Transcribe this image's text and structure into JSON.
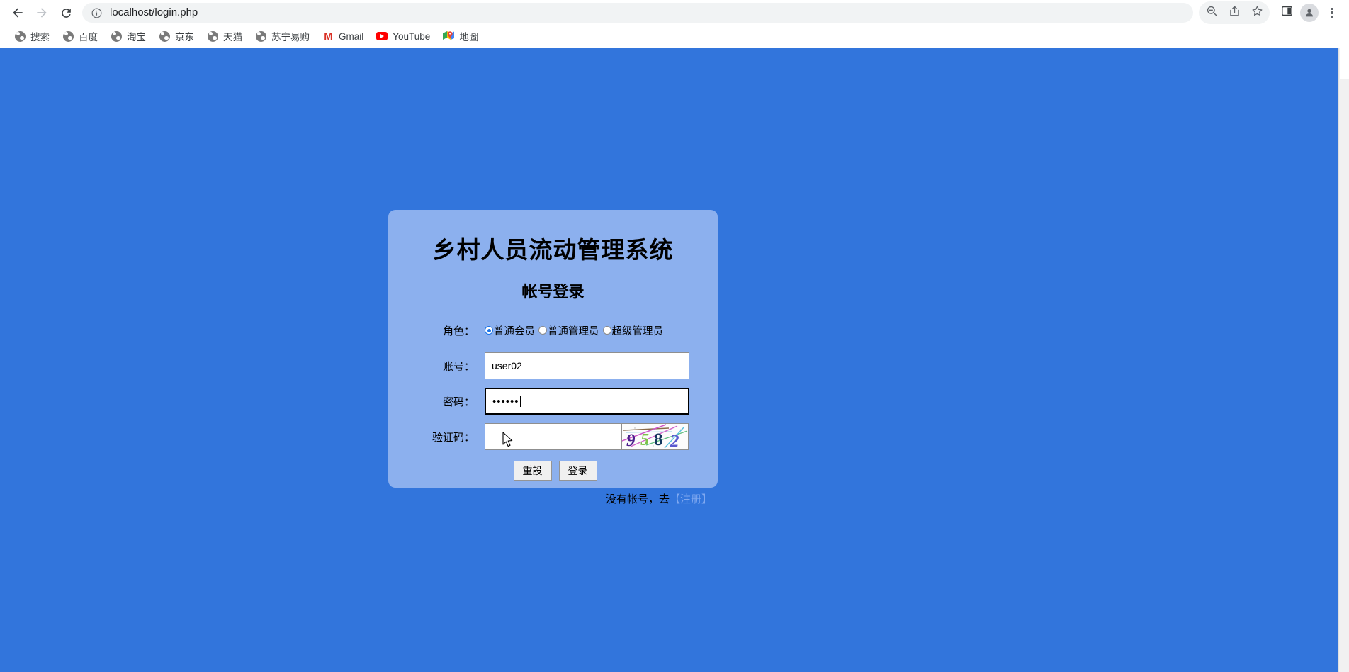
{
  "browser": {
    "nav": {
      "back_icon": "back-arrow-icon",
      "forward_icon": "forward-arrow-icon",
      "reload_icon": "reload-icon"
    },
    "omnibox": {
      "info_icon": "site-info-icon",
      "url": "localhost/login.php",
      "url_host": "localhost",
      "url_path": "/login.php"
    },
    "toolbar_icons": [
      {
        "name": "zoom-out-icon",
        "glyph": "search"
      },
      {
        "name": "share-icon",
        "glyph": "share"
      },
      {
        "name": "bookmark-star-icon",
        "glyph": "star"
      },
      {
        "name": "side-panel-icon",
        "glyph": "panel"
      },
      {
        "name": "profile-avatar-icon",
        "glyph": "person"
      },
      {
        "name": "chrome-menu-icon",
        "glyph": "dots"
      }
    ],
    "bookmarks": [
      {
        "label": "搜索",
        "icon": "globe-icon"
      },
      {
        "label": "百度",
        "icon": "globe-icon"
      },
      {
        "label": "淘宝",
        "icon": "globe-icon"
      },
      {
        "label": "京东",
        "icon": "globe-icon"
      },
      {
        "label": "天猫",
        "icon": "globe-icon"
      },
      {
        "label": "苏宁易购",
        "icon": "globe-icon"
      },
      {
        "label": "Gmail",
        "icon": "gmail-icon"
      },
      {
        "label": "YouTube",
        "icon": "youtube-icon"
      },
      {
        "label": "地圖",
        "icon": "google-maps-icon"
      }
    ]
  },
  "page": {
    "background_color": "#3275dc",
    "card_color": "#8cb0ee",
    "title": "乡村人员流动管理系统",
    "subtitle": "帐号登录",
    "form": {
      "role": {
        "label": "角色：",
        "options": [
          {
            "label": "普通会员",
            "selected": true
          },
          {
            "label": "普通管理员",
            "selected": false
          },
          {
            "label": "超级管理员",
            "selected": false
          }
        ]
      },
      "username": {
        "label": "账号：",
        "value": "user02",
        "placeholder": ""
      },
      "password": {
        "label": "密码：",
        "value": "••••••",
        "masked_length": 6,
        "placeholder": "",
        "focused": true
      },
      "captcha": {
        "label": "验证码：",
        "value": "",
        "placeholder": "",
        "image_text": "9582",
        "image_alt": "captcha-image"
      }
    },
    "buttons": {
      "reset": "重設",
      "submit": "登录"
    },
    "register": {
      "prefix": "没有帐号，去",
      "link": "【注册】",
      "link_color": "#7fa8f0"
    }
  }
}
